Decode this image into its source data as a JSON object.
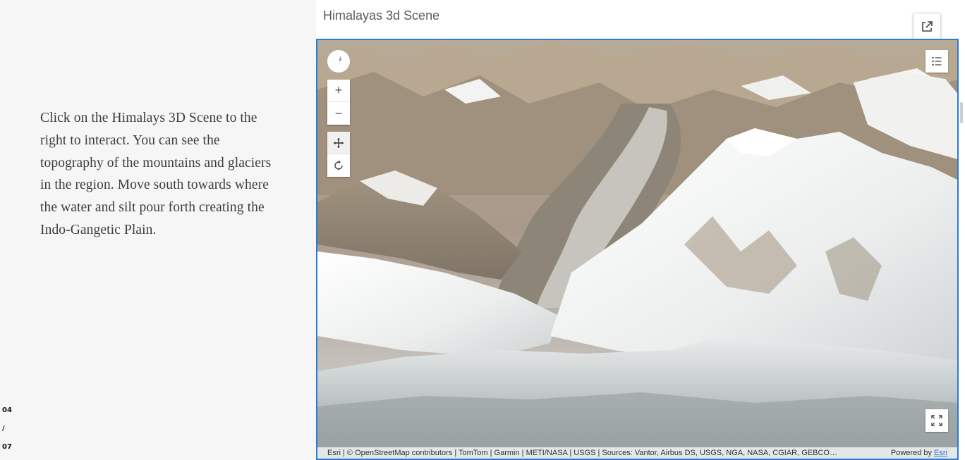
{
  "narrative": {
    "text": "Click on the Himalays 3D Scene to the right to interact. You can see the topography of the mountains and glaciers in the region. Move south towards where the water and silt pour forth creating the Indo-Gangetic Plain."
  },
  "progress": {
    "current": "04",
    "separator": "/",
    "total": "07"
  },
  "scene": {
    "title": "Himalayas 3d Scene",
    "open_new_icon": "open-in-new-window-icon",
    "controls": {
      "compass_icon": "compass-icon",
      "zoom_in": "+",
      "zoom_out": "−",
      "pan_icon": "pan-move-icon",
      "rotate_icon": "rotate-icon",
      "legend_icon": "legend-list-icon",
      "fullscreen_icon": "fullscreen-icon"
    },
    "attribution": "Esri | © OpenStreetMap contributors | TomTom | Garmin | METI/NASA | USGS | Sources: Vantor, Airbus DS, USGS, NGA, NASA, CGIAR, GEBCO…",
    "powered_by": "Powered by ",
    "powered_link": "Esri"
  },
  "colors": {
    "frame_border": "#2b7bd6",
    "left_background": "#f6f6f6",
    "text": "#3d3d3d"
  }
}
